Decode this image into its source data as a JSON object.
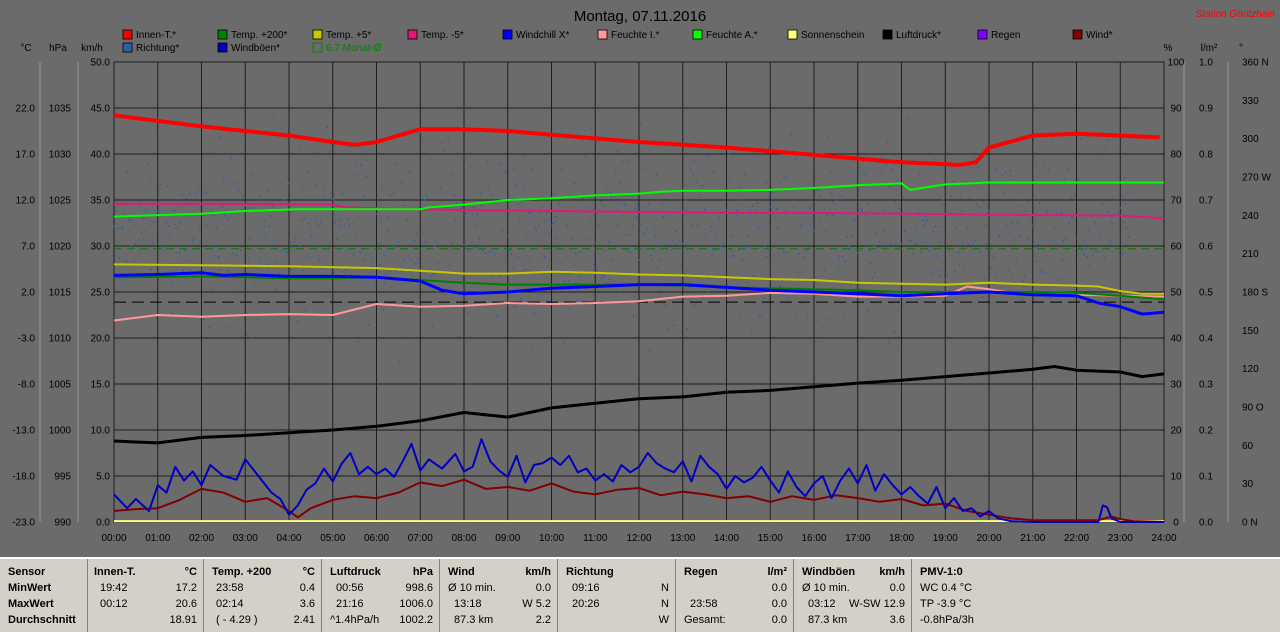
{
  "header": {
    "title": "Montag, 07.11.2016",
    "station": "Station Göritzhain"
  },
  "axis_units": {
    "celsius": "°C",
    "hpa": "hPa",
    "kmh": "km/h",
    "percent": "%",
    "lm2": "l/m²",
    "deg": "°"
  },
  "legend": [
    {
      "label": "Innen-T.*",
      "color": "#ff0000"
    },
    {
      "label": "Temp. +200*",
      "color": "#008000"
    },
    {
      "label": "Temp. +5*",
      "color": "#c8c800"
    },
    {
      "label": "Temp. -5*",
      "color": "#e0187c"
    },
    {
      "label": "Windchill X*",
      "color": "#0000ff"
    },
    {
      "label": "Feuchte I.*",
      "color": "#ff9898"
    },
    {
      "label": "Feuchte A.*",
      "color": "#00ff00"
    },
    {
      "label": "Sonnenschein",
      "color": "#ffff80"
    },
    {
      "label": "Luftdruck*",
      "color": "#000000"
    },
    {
      "label": "Regen",
      "color": "#8000ff"
    },
    {
      "label": "Wind*",
      "color": "#800000"
    },
    {
      "label": "Richtung*",
      "color": "#3060a0"
    },
    {
      "label": "Windböen*",
      "color": "#0000c0"
    },
    {
      "label": "6.7 Monat-Ø",
      "color": "#008000",
      "outline": true
    }
  ],
  "chart_data": {
    "type": "line",
    "x_unit": "time",
    "x_ticks": [
      "00:00",
      "01:00",
      "02:00",
      "03:00",
      "04:00",
      "05:00",
      "06:00",
      "07:00",
      "08:00",
      "09:00",
      "10:00",
      "11:00",
      "12:00",
      "13:00",
      "14:00",
      "15:00",
      "16:00",
      "17:00",
      "18:00",
      "19:00",
      "20:00",
      "21:00",
      "22:00",
      "23:00",
      "24:00"
    ],
    "left_axes": {
      "celsius": {
        "ticks": [
          "-23.0",
          "-18.0",
          "-13.0",
          "-8.0",
          "-3.0",
          "2.0",
          "7.0",
          "12.0",
          "17.0",
          "22.0"
        ],
        "range": [
          -23,
          27
        ]
      },
      "hpa": {
        "ticks": [
          "990",
          "995",
          "1000",
          "1005",
          "1010",
          "1015",
          "1020",
          "1025",
          "1030",
          "1035"
        ],
        "range": [
          990,
          1040
        ]
      },
      "kmh": {
        "ticks": [
          "0.0",
          "5.0",
          "10.0",
          "15.0",
          "20.0",
          "25.0",
          "30.0",
          "35.0",
          "40.0",
          "45.0",
          "50.0"
        ],
        "range": [
          0,
          50
        ]
      }
    },
    "right_axes": {
      "percent": {
        "ticks": [
          "0",
          "10",
          "20",
          "30",
          "40",
          "50",
          "60",
          "70",
          "80",
          "90",
          "100"
        ],
        "range": [
          0,
          100
        ]
      },
      "lm2": {
        "ticks": [
          "0.0",
          "0.1",
          "0.2",
          "0.3",
          "0.4",
          "0.5",
          "0.6",
          "0.7",
          "0.8",
          "0.9",
          "1.0"
        ],
        "range": [
          0,
          1
        ]
      },
      "deg": {
        "ticks": [
          "0 N",
          "30",
          "60",
          "90 O",
          "120",
          "150",
          "180 S",
          "210",
          "240",
          "270 W",
          "300",
          "330",
          "360 N"
        ],
        "range": [
          0,
          360
        ]
      }
    },
    "series": [
      {
        "name": "Innen-T.*",
        "color": "#ff0000",
        "width": 4,
        "unit": "kmh",
        "x": [
          0,
          1,
          2,
          3,
          4,
          5,
          5.5,
          6,
          7,
          8,
          9,
          10,
          11,
          12,
          13,
          14,
          15,
          16,
          17,
          18,
          19,
          19.3,
          19.7,
          20,
          21,
          22,
          23,
          23.9
        ],
        "y": [
          44.2,
          43.6,
          43.0,
          42.5,
          42.0,
          41.3,
          41.0,
          41.3,
          42.7,
          42.7,
          42.5,
          42.1,
          41.7,
          41.3,
          41.0,
          40.7,
          40.3,
          39.9,
          39.5,
          39.1,
          38.9,
          38.8,
          39.1,
          40.7,
          42.0,
          42.2,
          42.0,
          41.8
        ]
      },
      {
        "name": "Feuchte A.*",
        "color": "#00ff00",
        "width": 2,
        "unit": "kmh",
        "x": [
          0,
          2,
          3,
          4.2,
          4.5,
          5,
          7,
          7.2,
          8,
          9,
          10,
          11,
          12,
          12.5,
          13,
          14,
          15,
          16,
          17,
          18,
          18.2,
          19,
          20,
          24
        ],
        "y": [
          33.2,
          33.5,
          33.8,
          34.0,
          34.0,
          34.0,
          34.0,
          34.2,
          34.5,
          35.0,
          35.2,
          35.5,
          35.7,
          35.9,
          36.0,
          36.0,
          36.1,
          36.3,
          36.6,
          36.8,
          36.1,
          36.7,
          36.9,
          36.9
        ]
      },
      {
        "name": "Temp. -5*",
        "color": "#e0187c",
        "width": 2,
        "unit": "kmh",
        "x": [
          0,
          2,
          5,
          5.3,
          6,
          8,
          10,
          12,
          14,
          16,
          18,
          20,
          23,
          24
        ],
        "y": [
          34.6,
          34.6,
          34.5,
          34.2,
          34.1,
          33.9,
          33.8,
          33.7,
          33.6,
          33.6,
          33.5,
          33.4,
          33.3,
          33.0
        ]
      },
      {
        "name": "Temp. +5*",
        "color": "#c8c800",
        "width": 2,
        "unit": "kmh",
        "x": [
          0,
          2,
          4,
          6,
          7,
          8,
          9,
          10,
          11,
          12,
          13,
          14,
          15,
          16,
          17,
          18,
          19,
          20,
          21,
          22,
          22.5,
          23,
          23.5,
          24
        ],
        "y": [
          28.0,
          27.9,
          27.8,
          27.6,
          27.3,
          27.0,
          27.0,
          27.2,
          27.1,
          26.9,
          26.8,
          26.6,
          26.4,
          26.3,
          26.0,
          25.9,
          25.8,
          26.0,
          25.8,
          25.7,
          25.6,
          25.1,
          24.8,
          24.8
        ]
      },
      {
        "name": "Windchill X*",
        "color": "#0000ff",
        "width": 3,
        "unit": "kmh",
        "x": [
          0,
          1,
          2,
          2.5,
          3,
          4,
          5,
          6,
          7,
          7.5,
          8,
          9,
          10,
          11,
          12,
          13,
          14,
          15,
          16,
          17,
          18,
          19,
          20,
          21,
          22,
          22.5,
          23,
          23.5,
          24
        ],
        "y": [
          26.8,
          26.9,
          27.1,
          26.8,
          26.9,
          26.7,
          26.7,
          26.6,
          26.2,
          25.2,
          24.8,
          25.0,
          25.4,
          25.6,
          25.8,
          25.8,
          25.5,
          25.2,
          25.0,
          24.8,
          24.6,
          24.8,
          25.0,
          24.7,
          24.6,
          23.8,
          23.4,
          22.6,
          22.8
        ]
      },
      {
        "name": "Temp. +200*",
        "color": "#008000",
        "width": 2,
        "unit": "kmh",
        "x": [
          0,
          2,
          3,
          4,
          5,
          6,
          7,
          8,
          9,
          10,
          11,
          12,
          13,
          14,
          15,
          16,
          17,
          18,
          19,
          20,
          21,
          22,
          23,
          24
        ],
        "y": [
          26.6,
          26.7,
          26.6,
          26.5,
          26.5,
          26.6,
          26.3,
          26.0,
          25.8,
          25.8,
          25.8,
          25.8,
          25.7,
          25.5,
          25.4,
          25.3,
          25.2,
          25.0,
          25.0,
          25.0,
          25.0,
          24.9,
          24.6,
          24.2
        ]
      },
      {
        "name": "Feuchte I.*",
        "color": "#ff9898",
        "width": 2,
        "unit": "kmh",
        "x": [
          0,
          1,
          2,
          3,
          4,
          5,
          5.5,
          6,
          7,
          8,
          9,
          10,
          11,
          12,
          13,
          14,
          15,
          16,
          17,
          18,
          19,
          19.5,
          20,
          20.5,
          21,
          22,
          23,
          24
        ],
        "y": [
          21.9,
          22.5,
          22.3,
          22.5,
          22.6,
          22.5,
          23.1,
          23.7,
          23.4,
          23.5,
          23.8,
          23.7,
          23.8,
          24.0,
          24.5,
          24.6,
          24.9,
          24.8,
          24.5,
          24.5,
          24.6,
          25.6,
          25.3,
          24.9,
          24.7,
          24.7,
          24.6,
          24.5
        ]
      },
      {
        "name": "Luftdruck*",
        "color": "#000000",
        "width": 3,
        "unit": "kmh",
        "x": [
          0,
          1,
          2,
          3,
          4,
          5,
          6,
          7,
          8,
          9,
          10,
          11,
          12,
          13,
          14,
          15,
          16,
          17,
          18,
          19,
          20,
          21,
          21.5,
          22,
          23,
          23.5,
          24
        ],
        "y": [
          8.8,
          8.6,
          9.2,
          9.4,
          9.7,
          10.0,
          10.4,
          11.0,
          11.9,
          11.4,
          12.4,
          12.9,
          13.4,
          13.6,
          14.1,
          14.3,
          14.7,
          15.1,
          15.4,
          15.8,
          16.2,
          16.6,
          16.9,
          16.5,
          16.3,
          15.8,
          16.1
        ]
      },
      {
        "name": "Windböen*",
        "color": "#0000c0",
        "width": 2,
        "unit": "kmh",
        "x": [
          0,
          0.3,
          0.5,
          0.8,
          1,
          1.2,
          1.4,
          1.6,
          1.8,
          2,
          2.2,
          2.5,
          2.8,
          3,
          3.3,
          3.6,
          3.8,
          4,
          4.2,
          4.4,
          4.6,
          4.8,
          5,
          5.2,
          5.4,
          5.6,
          5.8,
          6,
          6.2,
          6.4,
          6.6,
          6.8,
          7,
          7.2,
          7.5,
          7.8,
          8,
          8.2,
          8.4,
          8.6,
          8.8,
          9,
          9.2,
          9.4,
          9.6,
          9.8,
          10,
          10.2,
          10.4,
          10.6,
          10.8,
          11,
          11.2,
          11.4,
          11.6,
          11.8,
          12,
          12.2,
          12.4,
          12.6,
          12.8,
          13,
          13.2,
          13.4,
          13.6,
          13.8,
          14,
          14.2,
          14.4,
          14.6,
          14.8,
          15,
          15.2,
          15.4,
          15.6,
          15.8,
          16,
          16.2,
          16.4,
          16.6,
          16.8,
          17,
          17.2,
          17.4,
          17.6,
          17.8,
          18,
          18.2,
          18.4,
          18.6,
          18.8,
          19,
          19.2,
          19.4,
          19.6,
          19.8,
          20,
          20.2,
          20.5,
          21,
          22,
          22.5,
          22.6,
          22.7,
          22.8,
          23,
          23.2,
          24
        ],
        "y": [
          3.0,
          1.5,
          2.5,
          1.2,
          4.0,
          3.2,
          6.0,
          4.5,
          5.5,
          4.0,
          6.2,
          5.0,
          4.6,
          6.8,
          5.0,
          3.2,
          2.5,
          0.8,
          1.8,
          3.5,
          4.2,
          5.8,
          4.4,
          6.3,
          7.5,
          5.2,
          6.0,
          5.2,
          5.8,
          4.9,
          6.6,
          8.5,
          5.6,
          6.8,
          5.8,
          7.4,
          5.5,
          6.0,
          9.0,
          6.6,
          5.6,
          4.9,
          7.2,
          4.3,
          6.2,
          6.4,
          7.0,
          6.2,
          7.2,
          5.4,
          5.8,
          4.5,
          5.2,
          4.4,
          6.2,
          5.4,
          6.0,
          7.5,
          6.4,
          5.8,
          5.4,
          6.6,
          4.4,
          7.2,
          6.0,
          5.2,
          3.6,
          5.0,
          4.3,
          4.8,
          6.0,
          4.5,
          3.2,
          5.5,
          3.8,
          2.8,
          4.2,
          5.0,
          2.6,
          4.5,
          5.8,
          4.2,
          6.2,
          3.4,
          5.2,
          4.0,
          3.0,
          3.8,
          2.8,
          2.0,
          3.8,
          1.5,
          2.6,
          1.2,
          1.5,
          0.6,
          1.2,
          0.4,
          0.1,
          0,
          0,
          0,
          1.8,
          1.6,
          0.4,
          0,
          0,
          0
        ]
      },
      {
        "name": "Wind*",
        "color": "#800000",
        "width": 2,
        "unit": "kmh",
        "x": [
          0,
          0.5,
          1,
          1.5,
          2,
          2.5,
          3,
          3.5,
          4,
          4.2,
          4.5,
          5,
          5.5,
          6,
          6.5,
          7,
          7.5,
          8,
          8.5,
          9,
          9.5,
          10,
          10.5,
          11,
          11.5,
          12,
          12.5,
          13,
          13.5,
          14,
          14.5,
          15,
          15.5,
          16,
          16.5,
          17,
          17.5,
          18,
          18.5,
          19,
          19.5,
          20,
          20.5,
          21,
          22.5,
          22.8,
          23,
          23.3,
          24
        ],
        "y": [
          1.2,
          1.4,
          1.5,
          2.4,
          3.6,
          3.2,
          2.2,
          2.6,
          1.2,
          0.5,
          1.5,
          2.4,
          2.8,
          2.6,
          3.2,
          4.3,
          3.9,
          4.6,
          3.6,
          3.8,
          3.4,
          4.2,
          3.3,
          3.0,
          3.5,
          3.7,
          2.9,
          3.3,
          3.0,
          2.6,
          2.8,
          2.2,
          2.8,
          2.4,
          2.9,
          2.6,
          2.2,
          2.5,
          1.8,
          2.0,
          1.2,
          0.8,
          0.4,
          0.2,
          0.2,
          0.6,
          0.3,
          0.1,
          0
        ]
      },
      {
        "name": "6.7 Monat-Ø",
        "color": "#008000",
        "width": 1,
        "dash": "8,5",
        "unit": "kmh",
        "x": [
          0,
          24
        ],
        "y": [
          29.7,
          29.7
        ]
      },
      {
        "name": "Sonnenschein",
        "color": "#ffff80",
        "width": 2,
        "unit": "kmh",
        "x": [
          0,
          24
        ],
        "y": [
          0.1,
          0.1
        ]
      }
    ],
    "reference_line": {
      "color": "#000000",
      "dash": "12,6",
      "unit": "kmh",
      "y": 23.9
    },
    "richtung_points": {
      "color": "#3060a0",
      "unit": "deg",
      "start_time": 0,
      "end_time": 23.2,
      "base": 225,
      "spread": 70,
      "min": 110,
      "max": 320
    }
  },
  "footer": {
    "sensor": {
      "title": "Sensor",
      "rows": [
        "MinWert",
        "MaxWert",
        "Durchschnitt"
      ]
    },
    "innen": {
      "title": "Innen-T.",
      "unit": "°C",
      "rows": [
        [
          "19:42",
          "17.2"
        ],
        [
          "00:12",
          "20.6"
        ],
        [
          "",
          "18.91"
        ]
      ]
    },
    "temp200": {
      "title": "Temp. +200",
      "unit": "°C",
      "rows": [
        [
          "23:58",
          "0.4"
        ],
        [
          "02:14",
          "3.6"
        ],
        [
          "( - 4.29 )",
          "2.41"
        ]
      ]
    },
    "luftdruck": {
      "title": "Luftdruck",
      "unit": "hPa",
      "rows": [
        [
          "00:56",
          "998.6"
        ],
        [
          "21:16",
          "1006.0"
        ],
        [
          "^1.4hPa/h",
          "1002.2"
        ]
      ]
    },
    "wind": {
      "title": "Wind",
      "unit": "km/h",
      "rows": [
        [
          "Ø 10 min.",
          "0.0"
        ],
        [
          "13:18",
          "W 5.2"
        ],
        [
          "87.3 km",
          "2.2"
        ]
      ]
    },
    "richtung": {
      "title": "Richtung",
      "unit": "",
      "rows": [
        [
          "09:16",
          "N"
        ],
        [
          "20:26",
          "N"
        ],
        [
          "",
          "W"
        ]
      ]
    },
    "regen": {
      "title": "Regen",
      "unit": "l/m²",
      "rows": [
        [
          "",
          "0.0"
        ],
        [
          "23:58",
          "0.0"
        ],
        [
          "Gesamt:",
          "0.0"
        ]
      ]
    },
    "windboeen": {
      "title": "Windböen",
      "unit": "km/h",
      "rows": [
        [
          "Ø 10 min.",
          "0.0"
        ],
        [
          "03:12",
          "W-SW 12.9"
        ],
        [
          "87.3 km",
          "3.6"
        ]
      ]
    },
    "pmv": {
      "title": "PMV-1:0",
      "rows": [
        "WC 0.4 °C",
        "TP -3.9 °C",
        "-0.8hPa/3h"
      ]
    }
  }
}
